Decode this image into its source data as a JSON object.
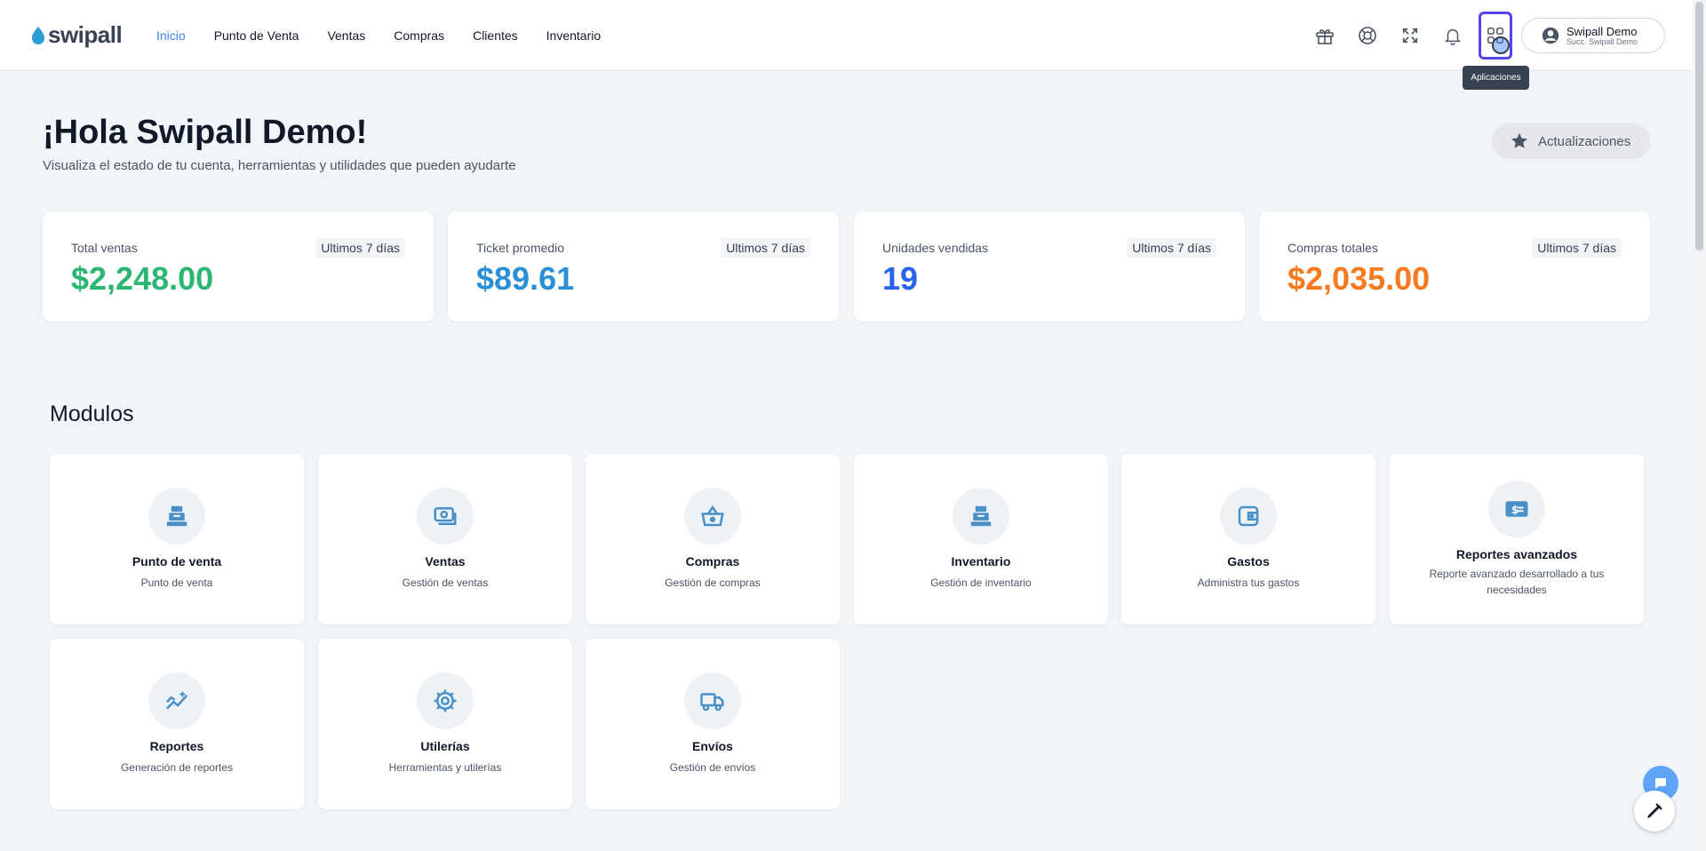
{
  "app": {
    "logo_text": "swipall"
  },
  "nav": {
    "items": [
      {
        "label": "Inicio",
        "active": true
      },
      {
        "label": "Punto de Venta"
      },
      {
        "label": "Ventas"
      },
      {
        "label": "Compras"
      },
      {
        "label": "Clientes"
      },
      {
        "label": "Inventario"
      }
    ]
  },
  "header": {
    "icons": [
      "gift-icon",
      "help-icon",
      "fullscreen-icon",
      "bell-icon",
      "apps-icon"
    ],
    "tooltip": "Aplicaciones",
    "user": {
      "name": "Swipall Demo",
      "branch": "Succ. Swipall Demo"
    }
  },
  "greeting": {
    "title": "¡Hola Swipall Demo!",
    "subtitle": "Visualiza el estado de tu cuenta, herramientas y utilidades que pueden ayudarte",
    "updates_label": "Actualizaciones"
  },
  "stats": [
    {
      "label": "Total ventas",
      "period": "Ultimos 7 días",
      "value": "$2,248.00",
      "color": "#2bb673"
    },
    {
      "label": "Ticket promedio",
      "period": "Ultimos 7 días",
      "value": "$89.61",
      "color": "#2b8fd6"
    },
    {
      "label": "Unidades vendidas",
      "period": "Ultimos 7 días",
      "value": "19",
      "color": "#2563eb"
    },
    {
      "label": "Compras totales",
      "period": "Ultimos 7 días",
      "value": "$2,035.00",
      "color": "#f47b20"
    }
  ],
  "modules": {
    "title": "Modulos",
    "items": [
      {
        "name": "Punto de venta",
        "desc": "Punto de venta",
        "icon": "cash-register-icon"
      },
      {
        "name": "Ventas",
        "desc": "Gestión de ventas",
        "icon": "money-icon"
      },
      {
        "name": "Compras",
        "desc": "Gestión de compras",
        "icon": "basket-icon"
      },
      {
        "name": "Inventario",
        "desc": "Gestión de inventario",
        "icon": "cash-register-icon"
      },
      {
        "name": "Gastos",
        "desc": "Administra tus gastos",
        "icon": "wallet-icon"
      },
      {
        "name": "Reportes avanzados",
        "desc": "Reporte avanzado desarrollado a tus necesidades",
        "icon": "dollar-report-icon"
      },
      {
        "name": "Reportes",
        "desc": "Generación de reportes",
        "icon": "trend-icon"
      },
      {
        "name": "Utilerías",
        "desc": "Herramientas y utilerías",
        "icon": "gear-icon"
      },
      {
        "name": "Envíos",
        "desc": "Gestión de envíos",
        "icon": "truck-icon"
      }
    ]
  },
  "colors": {
    "accent": "#3b82f6",
    "icon": "#4a90c8",
    "highlight": "#4f46e5"
  }
}
